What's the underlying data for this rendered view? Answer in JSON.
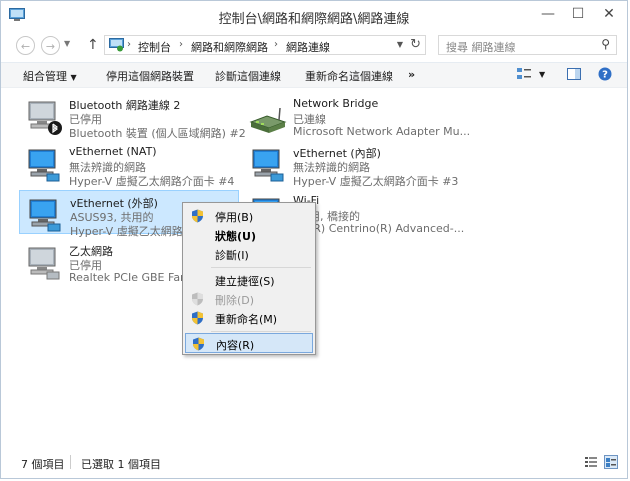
{
  "window": {
    "title": "控制台\\網路和網際網路\\網路連線",
    "minimize": "—",
    "maximize": "☐",
    "close": "✕"
  },
  "address": {
    "crumbs": [
      "控制台",
      "網路和網際網路",
      "網路連線"
    ],
    "search_placeholder": "搜尋 網路連線"
  },
  "toolbar": {
    "organize": "組合管理",
    "disable": "停用這個網路裝置",
    "diagnose": "診斷這個連線",
    "rename": "重新命名這個連線",
    "more": "»"
  },
  "items": [
    {
      "name": "Bluetooth 網路連線 2",
      "status": "已停用",
      "device": "Bluetooth 裝置 (個人區域網路) #2"
    },
    {
      "name": "Network Bridge",
      "status": "已連線",
      "device": "Microsoft Network Adapter Mu..."
    },
    {
      "name": "vEthernet (NAT)",
      "status": "無法辨識的網路",
      "device": "Hyper-V 虛擬乙太網路介面卡 #4"
    },
    {
      "name": "vEthernet (內部)",
      "status": "無法辨識的網路",
      "device": "Hyper-V 虛擬乙太網路介面卡 #3"
    },
    {
      "name": "vEthernet (外部)",
      "status": "ASUS93, 共用的",
      "device": "Hyper-V 虛擬乙太網路介"
    },
    {
      "name": "Wi-Fi",
      "status": "用, 橋接的",
      "device": "(R) Centrino(R) Advanced-..."
    },
    {
      "name": "乙太網路",
      "status": "已停用",
      "device": "Realtek PCIe GBE Fami"
    }
  ],
  "context_menu": [
    {
      "label": "停用(B)"
    },
    {
      "label": "狀態(U)"
    },
    {
      "label": "診斷(I)"
    },
    {
      "label": "建立捷徑(S)"
    },
    {
      "label": "刪除(D)"
    },
    {
      "label": "重新命名(M)"
    },
    {
      "label": "內容(R)"
    }
  ],
  "status": {
    "count": "7 個項目",
    "selected": "已選取 1 個項目"
  }
}
